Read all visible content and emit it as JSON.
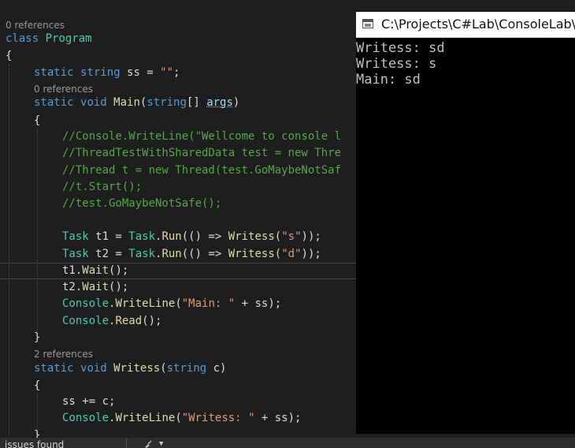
{
  "editor": {
    "lens_0_refs": "0 references",
    "lens_main_refs": "0 references",
    "lens_writess_refs": "2 references",
    "class_kw": "class",
    "class_name": "Program",
    "open_brace": "{",
    "close_brace": "}",
    "field": {
      "kw_static": "static",
      "kw_string": "string",
      "rest_before_str": " ss = ",
      "str_value": "\"\"",
      "rest_after": ";"
    },
    "main_sig": {
      "kw_static": "static",
      "kw_void": "void",
      "name": "Main",
      "paren_open": "(",
      "kw_string": "string",
      "brackets": "[] ",
      "param": "args",
      "paren_close": ")"
    },
    "comments": [
      "//Console.WriteLine(\"Wellcome to console l",
      "//ThreadTestWithSharedData test = new Thre",
      "//Thread t = new Thread(test.GoMaybeNotSaf",
      "//t.Start();",
      "//test.GoMaybeNotSafe();"
    ],
    "task1": {
      "type": "Task",
      "var": " t1 = ",
      "cls": "Task",
      "dot1": ".",
      "method": "Run",
      "mid": "(() => ",
      "call": "Writess",
      "open": "(",
      "arg": "\"s\"",
      "close": "));"
    },
    "task2": {
      "type": "Task",
      "var": " t2 = ",
      "cls": "Task",
      "dot1": ".",
      "method": "Run",
      "mid": "(() => ",
      "call": "Writess",
      "open": "(",
      "arg": "\"d\"",
      "close": "));"
    },
    "wait1": {
      "obj": "t1.",
      "method": "Wait",
      "rest": "();"
    },
    "wait2": {
      "obj": "t2.",
      "method": "Wait",
      "rest": "();"
    },
    "main_writeline": {
      "cls": "Console",
      "dot": ".",
      "method": "WriteLine",
      "open": "(",
      "str": "\"Main: \"",
      "rest": " + ss);"
    },
    "console_read": {
      "cls": "Console",
      "dot": ".",
      "method": "Read",
      "rest": "();"
    },
    "writess_sig": {
      "kw_static": "static",
      "kw_void": "void",
      "name": "Writess",
      "open": "(",
      "kw_string": "string",
      "rest": " c)"
    },
    "ss_append": "ss += c;",
    "writess_writeline": {
      "cls": "Console",
      "dot": ".",
      "method": "WriteLine",
      "open": "(",
      "str": "\"Writess: \"",
      "rest": " + ss);"
    }
  },
  "console_window": {
    "title": "C:\\Projects\\C#Lab\\ConsoleLab\\C",
    "output": [
      "Writess: sd",
      "Writess: s",
      "Main: sd"
    ]
  },
  "statusbar": {
    "issues_text": "issues found"
  },
  "colors": {
    "background": "#1e1e1e",
    "keyword": "#569cd6",
    "type": "#4ec9b0",
    "method": "#dcdcaa",
    "string": "#d69d85",
    "comment": "#57a64a",
    "parameter": "#9cdcfe"
  }
}
